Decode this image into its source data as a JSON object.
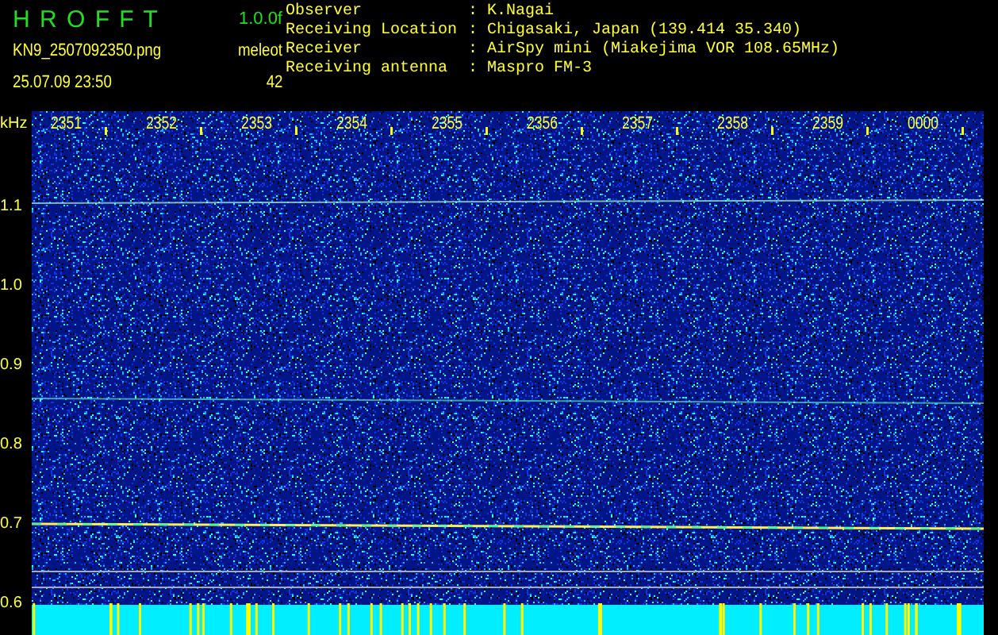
{
  "header": {
    "app_name": "H R O F F T",
    "version": "1.0.0f",
    "filename": "KN9_2507092350.png",
    "datetime": "25.07.09 23:50",
    "mode_label": "meleot",
    "count": "42"
  },
  "station_info": [
    {
      "label": "Observer",
      "separator": ":",
      "value": "K.Nagai"
    },
    {
      "label": "Receiving Location",
      "separator": ":",
      "value": "Chigasaki, Japan (139.414 35.340)"
    },
    {
      "label": "Receiver",
      "separator": ":",
      "value": "AirSpy mini (Miakejima VOR 108.65MHz)"
    },
    {
      "label": "Receiving antenna",
      "separator": ":",
      "value": "Maspro FM-3"
    }
  ],
  "spectrogram": {
    "y_unit": "kHz",
    "y_labels": [
      "1.1",
      "1.0",
      "0.9",
      "0.8",
      "0.7",
      "0.6"
    ],
    "time_labels": [
      "2351",
      "2352",
      "2353",
      "2354",
      "2355",
      "2356",
      "2357",
      "2358",
      "2359",
      "0000"
    ]
  }
}
